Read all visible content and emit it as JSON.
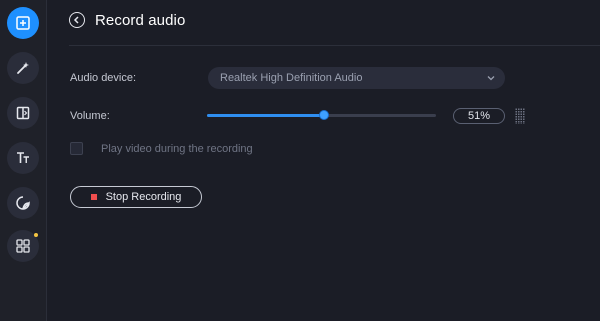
{
  "sidebar": {
    "items": [
      {
        "icon": "add-media-icon",
        "active": true
      },
      {
        "icon": "magic-wand-icon",
        "active": false
      },
      {
        "icon": "transitions-icon",
        "active": false
      },
      {
        "icon": "titles-icon",
        "active": false
      },
      {
        "icon": "stickers-icon",
        "active": false
      },
      {
        "icon": "more-tools-icon",
        "active": false,
        "has_notification": true
      }
    ],
    "accent_color": "#1e90ff",
    "notification_color": "#f4c542"
  },
  "header": {
    "title": "Record audio",
    "back_icon": "back-arrow-icon"
  },
  "form": {
    "audio_device_label": "Audio device:",
    "audio_device_value": "Realtek High Definition Audio",
    "volume_label": "Volume:",
    "volume_value": "51%",
    "volume_fraction": 0.51,
    "play_video_label": "Play video during the recording",
    "play_video_checked": false
  },
  "actions": {
    "stop_label": "Stop Recording",
    "stop_icon_color": "#f04e4e"
  }
}
